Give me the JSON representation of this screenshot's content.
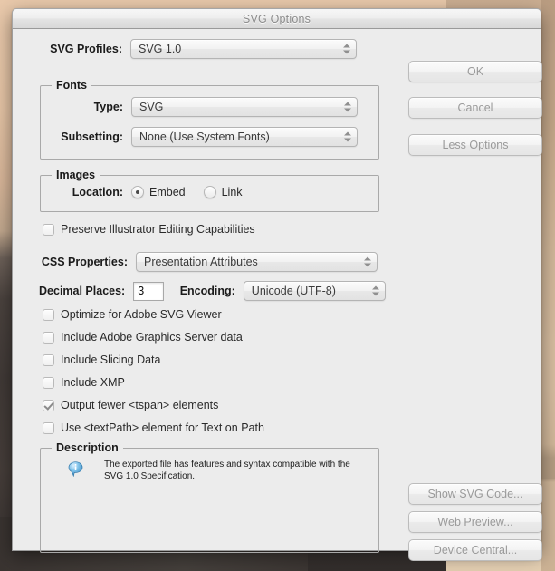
{
  "desktop": {
    "note": ""
  },
  "dialog": {
    "title": "SVG Options",
    "left": {
      "svg_profiles": {
        "label": "SVG Profiles:",
        "value": "SVG 1.0"
      },
      "fonts_group": {
        "legend": "Fonts",
        "type": {
          "label": "Type:",
          "value": "SVG"
        },
        "subsetting": {
          "label": "Subsetting:",
          "value": "None (Use System Fonts)"
        }
      },
      "images_group": {
        "legend": "Images",
        "location_label": "Location:",
        "options": [
          {
            "label": "Embed",
            "selected": true
          },
          {
            "label": "Link",
            "selected": false
          }
        ]
      },
      "preserve_checkbox": {
        "label": "Preserve Illustrator Editing Capabilities",
        "checked": false
      },
      "css_properties": {
        "label": "CSS Properties:",
        "value": "Presentation Attributes"
      },
      "decimal_places": {
        "label": "Decimal Places:",
        "value": "3"
      },
      "encoding": {
        "label": "Encoding:",
        "value": "Unicode (UTF-8)"
      },
      "checkboxes": [
        {
          "label": "Optimize for Adobe SVG Viewer",
          "checked": false
        },
        {
          "label": "Include Adobe Graphics Server data",
          "checked": false
        },
        {
          "label": "Include Slicing Data",
          "checked": false
        },
        {
          "label": "Include XMP",
          "checked": false
        },
        {
          "label": "Output fewer <tspan> elements",
          "checked": true
        },
        {
          "label": "Use <textPath> element for Text on Path",
          "checked": false
        }
      ],
      "description_group": {
        "legend": "Description",
        "text": "The exported file has features and syntax compatible with the SVG 1.0 Specification."
      }
    },
    "right": {
      "ok": "OK",
      "cancel": "Cancel",
      "less_options": "Less Options",
      "show_svg_code": "Show SVG Code...",
      "web_preview": "Web Preview...",
      "device_central": "Device Central..."
    }
  },
  "colors": {
    "dialog_bg": "#ececec",
    "titlebar_text": "#8c8c8c",
    "button_text": "#9a9a9a",
    "label_text": "#1b1b1b",
    "info_icon": "#6fb4e0"
  }
}
